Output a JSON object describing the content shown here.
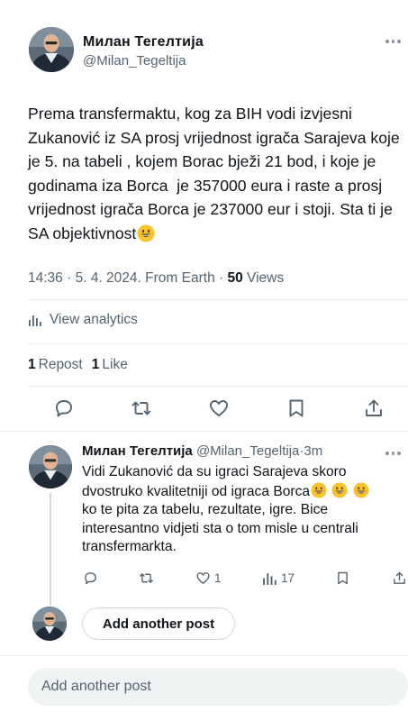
{
  "tweet": {
    "author_name": "Милан Тегелтија",
    "author_handle": "@Milan_Tegeltija",
    "text": "Prema transfermaktu, kog za BIH vodi izvjesni Zukanović iz SA prosj vrijednost igrača Sarajeva koje je 5. na tabeli , kojem Borac bježi 21 bod, i koje je godinama iza Borca  je 357000 eura i raste a prosj vrijednost igrača Borca je 237000 eur i stoji. Sta ti je SA objektivnost",
    "time": "14:36",
    "date": "5. 4. 2024.",
    "source": "From Earth",
    "views_count": "50",
    "views_label": "Views",
    "separator": "·"
  },
  "analytics": {
    "label": "View analytics"
  },
  "stats": {
    "reposts_count": "1",
    "reposts_label": "Repost",
    "likes_count": "1",
    "likes_label": "Like"
  },
  "reply": {
    "author_name": "Милан Тегелтија",
    "author_handle": "@Milan_Tegeltija",
    "time": "3m",
    "text_part1": "Vidi Zukanović da su igraci Sarajeva skoro dvostruko kvalitetniji od igraca Borca",
    "text_part2": "ko te pita za tabelu, rezultate, igre. Bice interesantno vidjeti sta o tom misle u centrali transfermarkta.",
    "likes": "1",
    "views": "17"
  },
  "add_another_button": "Add another post",
  "compose_placeholder": "Add another post",
  "colors": {
    "text_primary": "#0f1419",
    "text_secondary": "#536471",
    "divider": "#e6ecf0",
    "compose_bg": "#eff3f4"
  },
  "icons": [
    "more-icon",
    "analytics-icon",
    "reply-icon",
    "repost-icon",
    "like-icon",
    "bookmark-icon",
    "share-icon",
    "views-icon",
    "grinning-face-emoji"
  ]
}
